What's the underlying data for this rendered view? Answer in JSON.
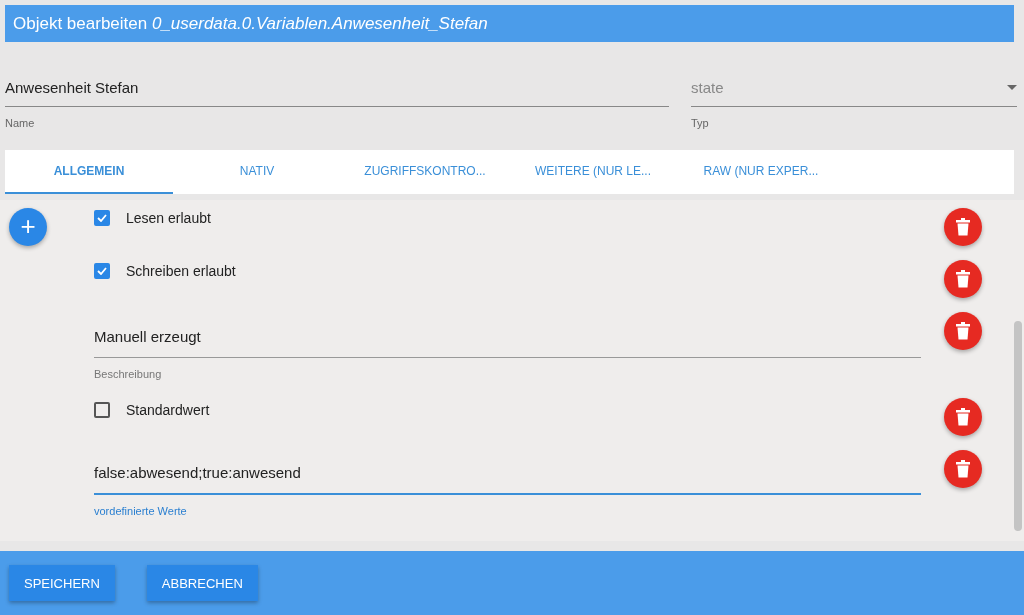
{
  "header": {
    "title": "Objekt bearbeiten *0_userdata.0.Variablen.Anwesenheit_Stefan*"
  },
  "name_field": {
    "value": "Anwesenheit Stefan",
    "label": "Name"
  },
  "type_select": {
    "value": "state",
    "label": "Typ"
  },
  "tabs": [
    {
      "label": "ALLGEMEIN",
      "selected": true
    },
    {
      "label": "NATIV",
      "selected": false
    },
    {
      "label": "ZUGRIFFSKONTRO...",
      "selected": false
    },
    {
      "label": "WEITERE (NUR LE...",
      "selected": false
    },
    {
      "label": "RAW (NUR EXPER...",
      "selected": false
    }
  ],
  "add_button": {
    "label": "+"
  },
  "rows": [
    {
      "kind": "checkbox",
      "label": "Lesen erlaubt",
      "checked": true
    },
    {
      "kind": "checkbox",
      "label": "Schreiben erlaubt",
      "checked": true
    },
    {
      "kind": "field",
      "value": "Manuell erzeugt",
      "helper": "Beschreibung",
      "focused": false
    },
    {
      "kind": "checkbox",
      "label": "Standardwert",
      "checked": false
    },
    {
      "kind": "field",
      "value": "false:abwesend;true:anwesend",
      "helper": "vordefinierte Werte",
      "focused": true
    }
  ],
  "buttons": [
    "SPEICHERN",
    "ABBRECHEN"
  ]
}
